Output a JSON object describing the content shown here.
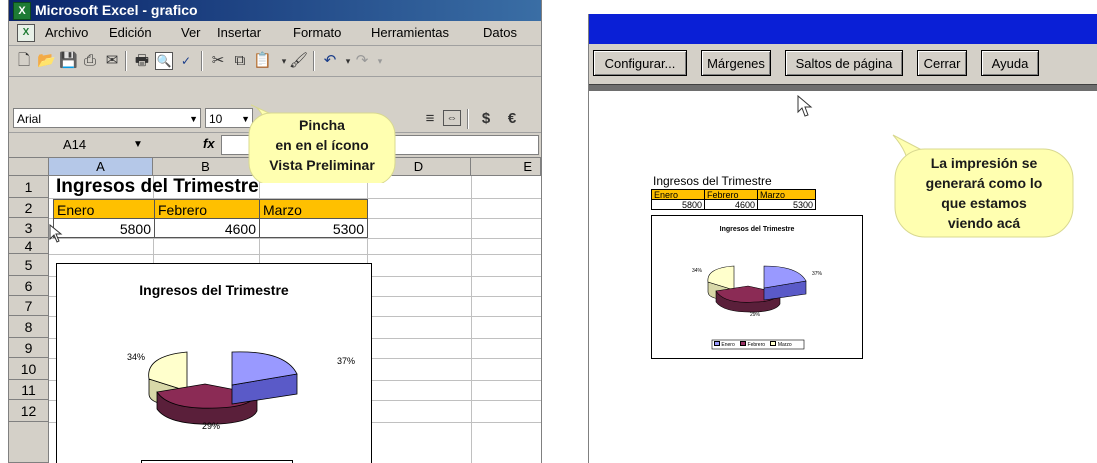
{
  "excel": {
    "title": "Microsoft Excel - grafico",
    "menu": [
      "Archivo",
      "Edición",
      "Ver",
      "Insertar",
      "Formato",
      "Herramientas",
      "Datos"
    ],
    "font_name": "Arial",
    "font_size": "10",
    "name_box": "A14",
    "fx_label": "fx",
    "columns": [
      "A",
      "B",
      "C",
      "D",
      "E"
    ],
    "rows": [
      "1",
      "2",
      "3",
      "4",
      "5",
      "6",
      "7",
      "8",
      "9",
      "10",
      "11",
      "12"
    ],
    "sheet_title": "Ingresos del Trimestre",
    "months": [
      "Enero",
      "Febrero",
      "Marzo"
    ],
    "values": [
      "5800",
      "4600",
      "5300"
    ],
    "chart": {
      "title": "Ingresos del Trimestre",
      "labels": [
        "34%",
        "37%",
        "29%"
      ]
    },
    "callout": [
      "Pincha",
      "en en el ícono",
      "Vista Preliminar"
    ]
  },
  "preview": {
    "buttons": [
      "Configurar...",
      "Márgenes",
      "Saltos de página",
      "Cerrar",
      "Ayuda"
    ],
    "sheet_title": "Ingresos del Trimestre",
    "months": [
      "Enero",
      "Febrero",
      "Marzo"
    ],
    "values": [
      "5800",
      "4600",
      "5300"
    ],
    "chart_title": "Ingresos del Trimestre",
    "chart_labels": [
      "34%",
      "37%",
      "29%"
    ],
    "legend": [
      "Enero",
      "Febrero",
      "Marzo"
    ],
    "callout": [
      "La impresión se",
      "generará como lo",
      "que estamos",
      "viendo acá"
    ]
  },
  "colors": {
    "header_yellow": "#ffc000",
    "slice_enero": "#9999ff",
    "slice_febrero": "#993366",
    "slice_marzo": "#ffffcc",
    "callout_fill": "#ffffb0",
    "title_bar": "#0a246a",
    "preview_title": "#0a1fd6"
  }
}
